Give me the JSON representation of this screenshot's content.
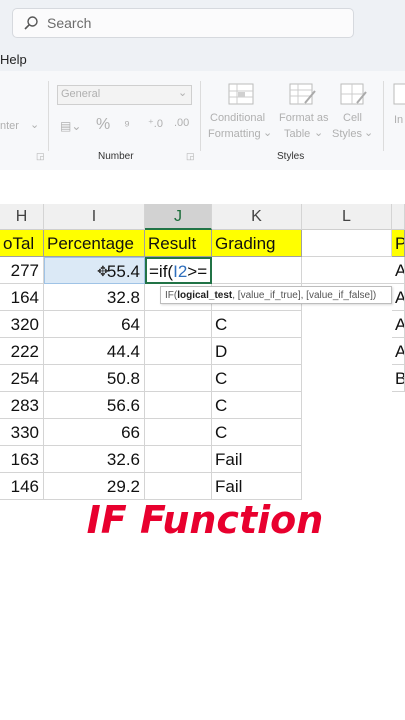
{
  "search": {
    "placeholder": "Search"
  },
  "menu": {
    "help": "Help"
  },
  "ribbon": {
    "alignment_partial": "nter",
    "number_format": "General",
    "number_group": "Number",
    "conditional_formatting_1": "Conditional",
    "conditional_formatting_2": "Formatting",
    "format_as_table_1": "Format as",
    "format_as_table_2": "Table",
    "cell_styles_1": "Cell",
    "cell_styles_2": "Styles",
    "styles_group": "Styles",
    "insert_partial": "In"
  },
  "columns": [
    "H",
    "I",
    "J",
    "K",
    "L"
  ],
  "headers": {
    "h": "oTal",
    "i": "Percentage",
    "j": "Result",
    "k": "Grading",
    "p": "P"
  },
  "rows": [
    {
      "h": "277",
      "i": "55.4",
      "j": "=if(",
      "j_ref": "I2",
      "j_tail": ">=",
      "k": "",
      "p": "A"
    },
    {
      "h": "164",
      "i": "32.8",
      "j": "",
      "k": "",
      "p": "A"
    },
    {
      "h": "320",
      "i": "64",
      "j": "",
      "k": "C",
      "p": "A"
    },
    {
      "h": "222",
      "i": "44.4",
      "j": "",
      "k": "D",
      "p": "A"
    },
    {
      "h": "254",
      "i": "50.8",
      "j": "",
      "k": "C",
      "p": "B"
    },
    {
      "h": "283",
      "i": "56.6",
      "j": "",
      "k": "C",
      "p": ""
    },
    {
      "h": "330",
      "i": "66",
      "j": "",
      "k": "C",
      "p": ""
    },
    {
      "h": "163",
      "i": "32.6",
      "j": "",
      "k": "Fail",
      "p": ""
    },
    {
      "h": "146",
      "i": "29.2",
      "j": "",
      "k": "Fail",
      "p": ""
    }
  ],
  "tooltip": {
    "prefix": "IF(",
    "arg1": "logical_test",
    "rest": ", [value_if_true], [value_if_false])"
  },
  "overlay": {
    "title": "IF Function"
  }
}
